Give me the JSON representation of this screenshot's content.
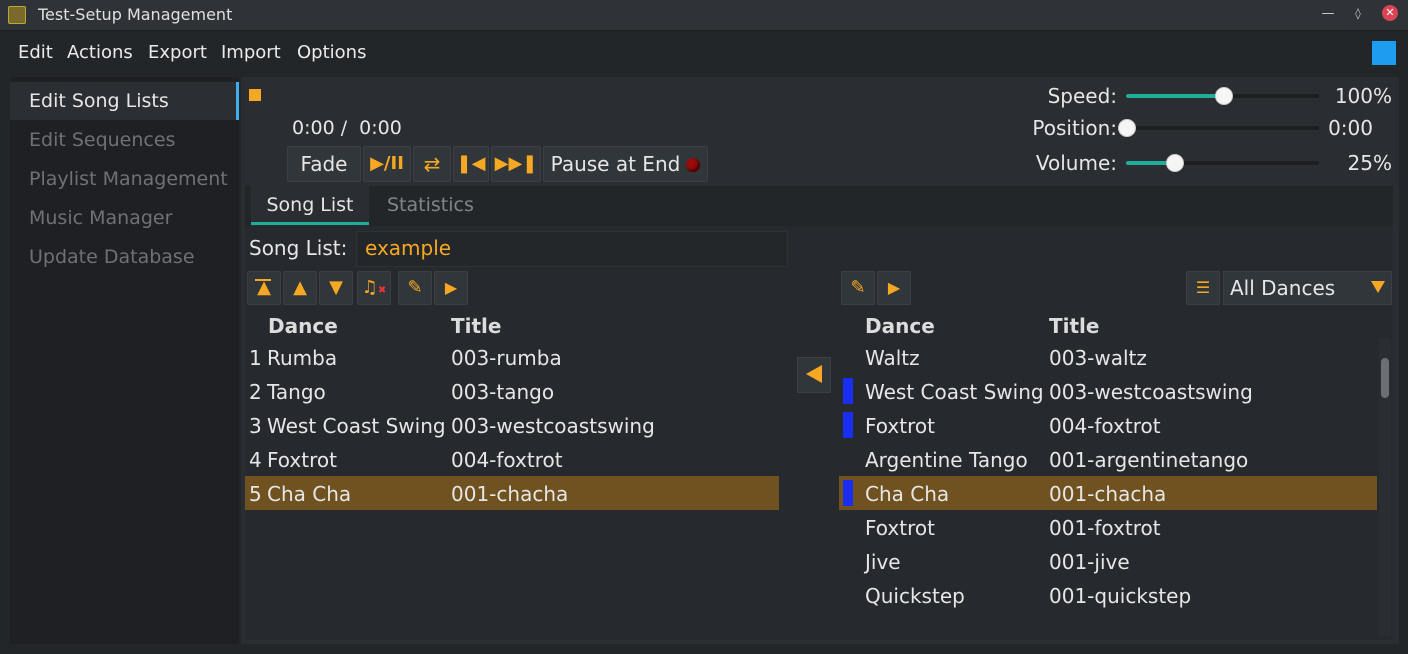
{
  "window": {
    "title": "Test-Setup Management"
  },
  "menu": {
    "items": [
      "Edit",
      "Actions",
      "Export",
      "Import",
      "Options"
    ]
  },
  "sidebar": {
    "items": [
      {
        "label": "Edit Song Lists",
        "active": true
      },
      {
        "label": "Edit Sequences",
        "active": false
      },
      {
        "label": "Playlist Management",
        "active": false
      },
      {
        "label": "Music Manager",
        "active": false
      },
      {
        "label": "Update Database",
        "active": false
      }
    ]
  },
  "player": {
    "time": "0:00 /  0:00",
    "fade_label": "Fade",
    "play_pause_label": "▶/II",
    "pause_at_end_label": "Pause at End",
    "speed": {
      "label": "Speed:",
      "value": "100%",
      "level": 0.5
    },
    "position": {
      "label": "Position:",
      "value": "0:00",
      "level": 0.0
    },
    "volume": {
      "label": "Volume:",
      "value": "25%",
      "level": 0.25
    }
  },
  "tabs": {
    "song_list": "Song List",
    "statistics": "Statistics"
  },
  "songlist": {
    "label": "Song List:",
    "value": "example"
  },
  "left_table": {
    "headers": {
      "dance": "Dance",
      "title": "Title"
    },
    "rows": [
      {
        "num": "1",
        "dance": "Rumba",
        "title": "003-rumba"
      },
      {
        "num": "2",
        "dance": "Tango",
        "title": "003-tango"
      },
      {
        "num": "3",
        "dance": "West Coast Swing",
        "title": "003-westcoastswing"
      },
      {
        "num": "4",
        "dance": "Foxtrot",
        "title": "004-foxtrot"
      },
      {
        "num": "5",
        "dance": "Cha Cha",
        "title": "001-chacha"
      }
    ]
  },
  "right_table": {
    "filter": "All Dances",
    "headers": {
      "dance": "Dance",
      "title": "Title"
    },
    "rows": [
      {
        "dance": "Waltz",
        "title": "003-waltz"
      },
      {
        "dance": "West Coast Swing",
        "title": "003-westcoastswing"
      },
      {
        "dance": "Foxtrot",
        "title": "004-foxtrot"
      },
      {
        "dance": "Argentine Tango",
        "title": "001-argentinetango"
      },
      {
        "dance": "Cha Cha",
        "title": "001-chacha"
      },
      {
        "dance": "Foxtrot",
        "title": "001-foxtrot"
      },
      {
        "dance": "Jive",
        "title": "001-jive"
      },
      {
        "dance": "Quickstep",
        "title": "001-quickstep"
      }
    ]
  },
  "colors": {
    "accent": "#f7a823",
    "selection": "#6f5220",
    "slider": "#1fae99",
    "marker": "#1a2ef0"
  }
}
